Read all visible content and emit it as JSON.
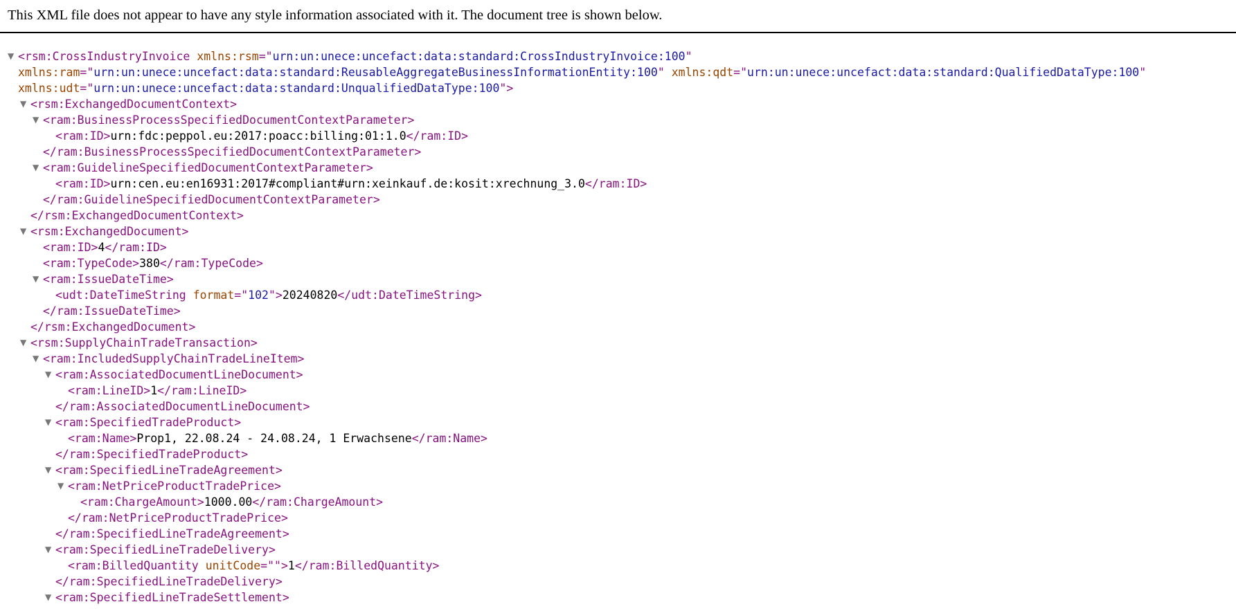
{
  "header": {
    "notice": "This XML file does not appear to have any style information associated with it. The document tree is shown below."
  },
  "tree": [
    {
      "d": 0,
      "t": 1,
      "p": [
        [
          "tag",
          "<rsm:CrossIndustryInvoice "
        ],
        [
          "attr-name",
          "xmlns:rsm"
        ],
        [
          "tag",
          "=\""
        ],
        [
          "attr-val",
          "urn:un:unece:uncefact:data:standard:CrossIndustryInvoice:100"
        ],
        [
          "tag",
          "\""
        ]
      ]
    },
    {
      "d": 0,
      "t": 0,
      "p": [
        [
          "attr-name",
          "xmlns:ram"
        ],
        [
          "tag",
          "=\""
        ],
        [
          "attr-val",
          "urn:un:unece:uncefact:data:standard:ReusableAggregateBusinessInformationEntity:100"
        ],
        [
          "tag",
          "\" "
        ],
        [
          "attr-name",
          "xmlns:qdt"
        ],
        [
          "tag",
          "=\""
        ],
        [
          "attr-val",
          "urn:un:unece:uncefact:data:standard:QualifiedDataType:100"
        ],
        [
          "tag",
          "\""
        ]
      ]
    },
    {
      "d": 0,
      "t": 0,
      "p": [
        [
          "attr-name",
          "xmlns:udt"
        ],
        [
          "tag",
          "=\""
        ],
        [
          "attr-val",
          "urn:un:unece:uncefact:data:standard:UnqualifiedDataType:100"
        ],
        [
          "tag",
          "\">"
        ]
      ]
    },
    {
      "d": 1,
      "t": 1,
      "p": [
        [
          "tag",
          "<rsm:ExchangedDocumentContext>"
        ]
      ]
    },
    {
      "d": 2,
      "t": 1,
      "p": [
        [
          "tag",
          "<ram:BusinessProcessSpecifiedDocumentContextParameter>"
        ]
      ]
    },
    {
      "d": 3,
      "t": 0,
      "p": [
        [
          "tag",
          "<ram:ID>"
        ],
        [
          "text",
          "urn:fdc:peppol.eu:2017:poacc:billing:01:1.0"
        ],
        [
          "tag",
          "</ram:ID>"
        ]
      ]
    },
    {
      "d": 2,
      "t": 0,
      "p": [
        [
          "tag",
          "</ram:BusinessProcessSpecifiedDocumentContextParameter>"
        ]
      ]
    },
    {
      "d": 2,
      "t": 1,
      "p": [
        [
          "tag",
          "<ram:GuidelineSpecifiedDocumentContextParameter>"
        ]
      ]
    },
    {
      "d": 3,
      "t": 0,
      "p": [
        [
          "tag",
          "<ram:ID>"
        ],
        [
          "text",
          "urn:cen.eu:en16931:2017#compliant#urn:xeinkauf.de:kosit:xrechnung_3.0"
        ],
        [
          "tag",
          "</ram:ID>"
        ]
      ]
    },
    {
      "d": 2,
      "t": 0,
      "p": [
        [
          "tag",
          "</ram:GuidelineSpecifiedDocumentContextParameter>"
        ]
      ]
    },
    {
      "d": 1,
      "t": 0,
      "p": [
        [
          "tag",
          "</rsm:ExchangedDocumentContext>"
        ]
      ]
    },
    {
      "d": 1,
      "t": 1,
      "p": [
        [
          "tag",
          "<rsm:ExchangedDocument>"
        ]
      ]
    },
    {
      "d": 2,
      "t": 0,
      "p": [
        [
          "tag",
          "<ram:ID>"
        ],
        [
          "text",
          "4"
        ],
        [
          "tag",
          "</ram:ID>"
        ]
      ]
    },
    {
      "d": 2,
      "t": 0,
      "p": [
        [
          "tag",
          "<ram:TypeCode>"
        ],
        [
          "text",
          "380"
        ],
        [
          "tag",
          "</ram:TypeCode>"
        ]
      ]
    },
    {
      "d": 2,
      "t": 1,
      "p": [
        [
          "tag",
          "<ram:IssueDateTime>"
        ]
      ]
    },
    {
      "d": 3,
      "t": 0,
      "p": [
        [
          "tag",
          "<udt:DateTimeString "
        ],
        [
          "attr-name",
          "format"
        ],
        [
          "tag",
          "=\""
        ],
        [
          "attr-val",
          "102"
        ],
        [
          "tag",
          "\">"
        ],
        [
          "text",
          "20240820"
        ],
        [
          "tag",
          "</udt:DateTimeString>"
        ]
      ]
    },
    {
      "d": 2,
      "t": 0,
      "p": [
        [
          "tag",
          "</ram:IssueDateTime>"
        ]
      ]
    },
    {
      "d": 1,
      "t": 0,
      "p": [
        [
          "tag",
          "</rsm:ExchangedDocument>"
        ]
      ]
    },
    {
      "d": 1,
      "t": 1,
      "p": [
        [
          "tag",
          "<rsm:SupplyChainTradeTransaction>"
        ]
      ]
    },
    {
      "d": 2,
      "t": 1,
      "p": [
        [
          "tag",
          "<ram:IncludedSupplyChainTradeLineItem>"
        ]
      ]
    },
    {
      "d": 3,
      "t": 1,
      "p": [
        [
          "tag",
          "<ram:AssociatedDocumentLineDocument>"
        ]
      ]
    },
    {
      "d": 4,
      "t": 0,
      "p": [
        [
          "tag",
          "<ram:LineID>"
        ],
        [
          "text",
          "1"
        ],
        [
          "tag",
          "</ram:LineID>"
        ]
      ]
    },
    {
      "d": 3,
      "t": 0,
      "p": [
        [
          "tag",
          "</ram:AssociatedDocumentLineDocument>"
        ]
      ]
    },
    {
      "d": 3,
      "t": 1,
      "p": [
        [
          "tag",
          "<ram:SpecifiedTradeProduct>"
        ]
      ]
    },
    {
      "d": 4,
      "t": 0,
      "p": [
        [
          "tag",
          "<ram:Name>"
        ],
        [
          "text",
          "Prop1, 22.08.24 - 24.08.24, 1 Erwachsene"
        ],
        [
          "tag",
          "</ram:Name>"
        ]
      ]
    },
    {
      "d": 3,
      "t": 0,
      "p": [
        [
          "tag",
          "</ram:SpecifiedTradeProduct>"
        ]
      ]
    },
    {
      "d": 3,
      "t": 1,
      "p": [
        [
          "tag",
          "<ram:SpecifiedLineTradeAgreement>"
        ]
      ]
    },
    {
      "d": 4,
      "t": 1,
      "p": [
        [
          "tag",
          "<ram:NetPriceProductTradePrice>"
        ]
      ]
    },
    {
      "d": 5,
      "t": 0,
      "p": [
        [
          "tag",
          "<ram:ChargeAmount>"
        ],
        [
          "text",
          "1000.00"
        ],
        [
          "tag",
          "</ram:ChargeAmount>"
        ]
      ]
    },
    {
      "d": 4,
      "t": 0,
      "p": [
        [
          "tag",
          "</ram:NetPriceProductTradePrice>"
        ]
      ]
    },
    {
      "d": 3,
      "t": 0,
      "p": [
        [
          "tag",
          "</ram:SpecifiedLineTradeAgreement>"
        ]
      ]
    },
    {
      "d": 3,
      "t": 1,
      "p": [
        [
          "tag",
          "<ram:SpecifiedLineTradeDelivery>"
        ]
      ]
    },
    {
      "d": 4,
      "t": 0,
      "p": [
        [
          "tag",
          "<ram:BilledQuantity "
        ],
        [
          "attr-name",
          "unitCode"
        ],
        [
          "tag",
          "=\""
        ],
        [
          "attr-val",
          ""
        ],
        [
          "tag",
          "\">"
        ],
        [
          "text",
          "1"
        ],
        [
          "tag",
          "</ram:BilledQuantity>"
        ]
      ]
    },
    {
      "d": 3,
      "t": 0,
      "p": [
        [
          "tag",
          "</ram:SpecifiedLineTradeDelivery>"
        ]
      ]
    },
    {
      "d": 3,
      "t": 1,
      "p": [
        [
          "tag",
          "<ram:SpecifiedLineTradeSettlement>"
        ]
      ]
    }
  ]
}
